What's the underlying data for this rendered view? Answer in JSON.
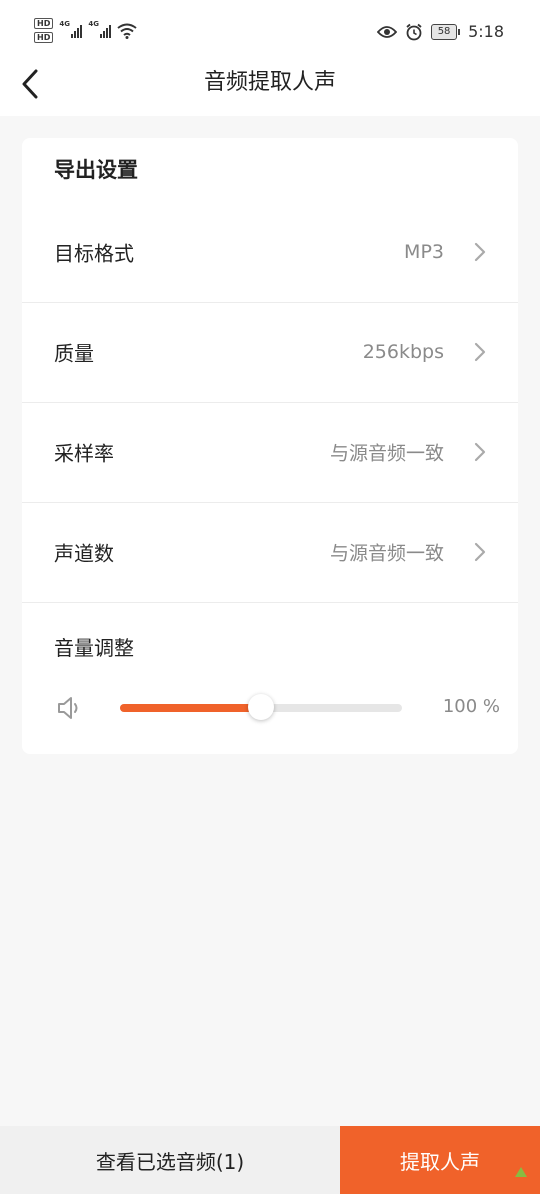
{
  "status_bar": {
    "hd1": "HD",
    "hd2": "HD",
    "net1": "4G",
    "net2": "4G",
    "battery": "58",
    "time": "5:18"
  },
  "nav": {
    "title": "音频提取人声"
  },
  "settings": {
    "section_title": "导出设置",
    "rows": [
      {
        "label": "目标格式",
        "value": "MP3"
      },
      {
        "label": "质量",
        "value": "256kbps"
      },
      {
        "label": "采样率",
        "value": "与源音频一致"
      },
      {
        "label": "声道数",
        "value": "与源音频一致"
      }
    ],
    "volume": {
      "label": "音量调整",
      "value_text": "100 %",
      "level": 0.5
    }
  },
  "bottom": {
    "view_selected": "查看已选音频(1)",
    "extract": "提取人声"
  },
  "colors": {
    "accent": "#f0622a",
    "secondary_text": "#8a8a8a"
  }
}
